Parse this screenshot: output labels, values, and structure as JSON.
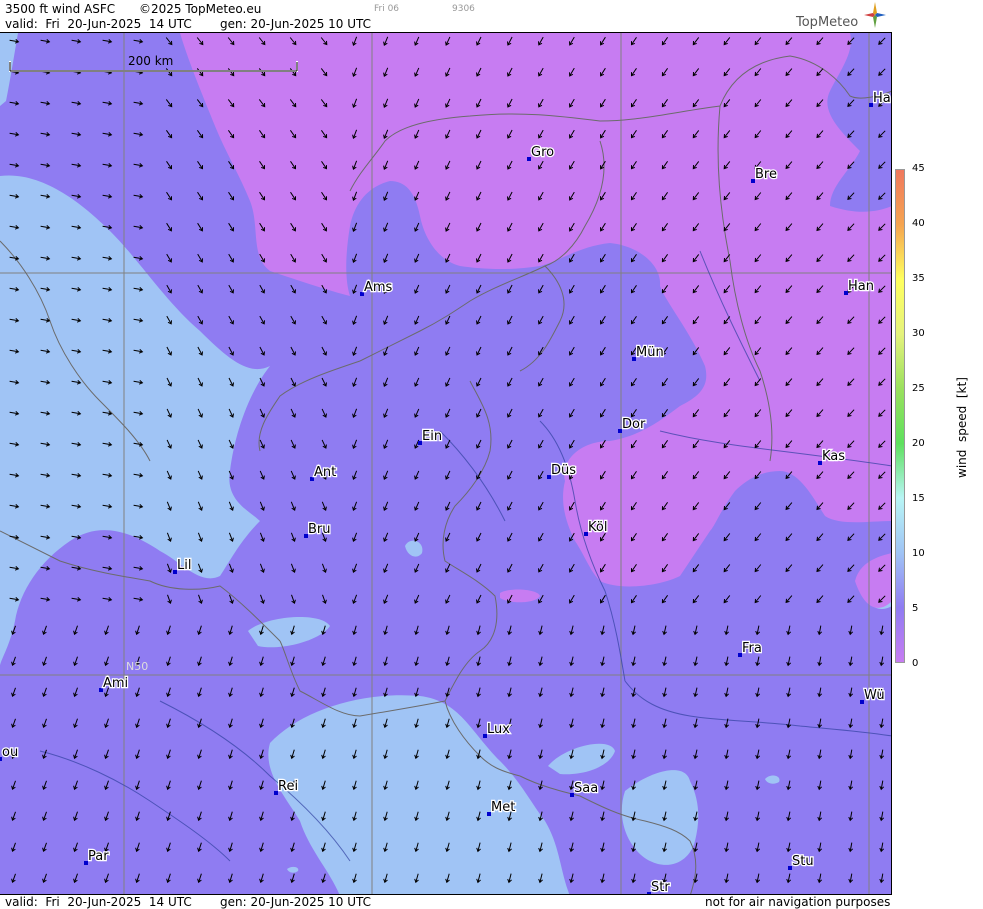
{
  "header": {
    "product": "3500 ft wind ASFC",
    "copyright": "©2025 TopMeteo.eu",
    "day_code": "Fri 06",
    "run_code": "9306",
    "valid_line": "valid:  Fri  20-Jun-2025  14 UTC",
    "gen_line": "gen: 20-Jun-2025 10 UTC",
    "logo_text": "TopMeteo"
  },
  "map": {
    "scale_label": "200 km",
    "latitude_label": "N50",
    "cities": [
      {
        "name": "Gro"
      },
      {
        "name": "Bre"
      },
      {
        "name": "Ha"
      },
      {
        "name": "Ams"
      },
      {
        "name": "Han"
      },
      {
        "name": "Mün"
      },
      {
        "name": "Ein"
      },
      {
        "name": "Dor"
      },
      {
        "name": "Ant"
      },
      {
        "name": "Düs"
      },
      {
        "name": "Kas"
      },
      {
        "name": "Bru"
      },
      {
        "name": "Köl"
      },
      {
        "name": "Lil"
      },
      {
        "name": "Fra"
      },
      {
        "name": "Ami"
      },
      {
        "name": "Wü"
      },
      {
        "name": "ou"
      },
      {
        "name": "Lux"
      },
      {
        "name": "Rei"
      },
      {
        "name": "Saa"
      },
      {
        "name": "Met"
      },
      {
        "name": "Par"
      },
      {
        "name": "Stu"
      },
      {
        "name": "Str"
      }
    ]
  },
  "footer": {
    "valid_line": "valid:  Fri  20-Jun-2025  14 UTC",
    "gen_line": "gen: 20-Jun-2025 10 UTC",
    "disclaimer": "not for air navigation purposes"
  },
  "legend": {
    "title": "wind  speed  [kt]",
    "ticks": [
      "45",
      "40",
      "35",
      "30",
      "25",
      "20",
      "15",
      "10",
      "5",
      "0"
    ],
    "colors": {
      "0": "#c77cf2",
      "5": "#8f7cf2",
      "10": "#a0c4f5",
      "15": "#b8f5f5",
      "20": "#5ee05e",
      "25": "#9be05e",
      "30": "#e5f27c",
      "35": "#ffff5e",
      "40": "#f5a450",
      "45": "#f0785e"
    }
  }
}
